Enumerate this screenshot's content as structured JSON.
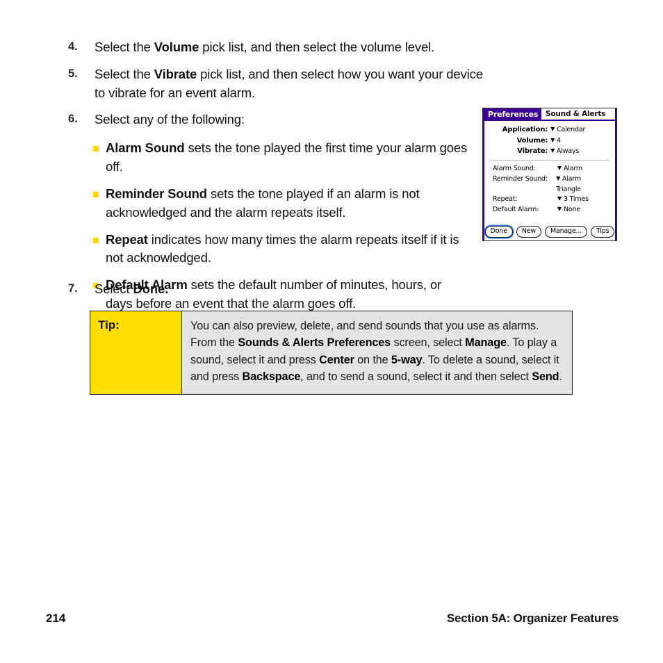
{
  "steps": [
    {
      "number": "4.",
      "parts": [
        {
          "t": "Select the ",
          "b": false
        },
        {
          "t": "Volume",
          "b": true
        },
        {
          "t": " pick list, and then select the volume level.",
          "b": false
        }
      ]
    },
    {
      "number": "5.",
      "parts": [
        {
          "t": "Select the ",
          "b": false
        },
        {
          "t": "Vibrate",
          "b": true
        },
        {
          "t": " pick list, and then select how you want your device to vibrate for an event alarm.",
          "b": false
        }
      ]
    },
    {
      "number": "6.",
      "parts": [
        {
          "t": "Select any of the following:",
          "b": false
        }
      ]
    }
  ],
  "bullets": [
    {
      "parts": [
        {
          "t": "Alarm Sound",
          "b": true
        },
        {
          "t": " sets the tone played the first time your alarm goes off.",
          "b": false
        }
      ]
    },
    {
      "parts": [
        {
          "t": "Reminder Sound",
          "b": true
        },
        {
          "t": " sets the tone played if an alarm  is not acknowledged and the alarm repeats itself.",
          "b": false
        }
      ]
    },
    {
      "parts": [
        {
          "t": "Repeat",
          "b": true
        },
        {
          "t": " indicates how many times the alarm repeats itself if it is not acknowledged.",
          "b": false
        }
      ]
    },
    {
      "parts": [
        {
          "t": "Default Alarm",
          "b": true
        },
        {
          "t": " sets the default number of minutes, hours, or days before an event that the alarm goes off.",
          "b": false
        }
      ]
    }
  ],
  "step7": {
    "number": "7.",
    "parts": [
      {
        "t": "Select ",
        "b": false
      },
      {
        "t": "Done.",
        "b": true
      }
    ]
  },
  "device": {
    "tab_label": "Preferences",
    "screen_title": "Sound & Alerts",
    "top_fields": [
      {
        "label": "Application:",
        "value": "Calendar"
      },
      {
        "label": "Volume:",
        "value": "4"
      },
      {
        "label": "Vibrate:",
        "value": "Always"
      }
    ],
    "lower_fields": [
      {
        "label": "Alarm Sound:",
        "value": "Alarm"
      },
      {
        "label": "Reminder Sound:",
        "value": "Alarm Triangle"
      },
      {
        "label": "Repeat:",
        "value": "3 Times"
      },
      {
        "label": "Default Alarm:",
        "value": "None"
      }
    ],
    "buttons": [
      {
        "label": "Done",
        "focused": true
      },
      {
        "label": "New",
        "focused": false
      },
      {
        "label": "Manage...",
        "focused": false
      },
      {
        "label": "Tips",
        "focused": false
      }
    ],
    "arrow_glyph": "▼",
    "colors": {
      "title_bg": "#3A0095",
      "title_fg": "#FFFFFF",
      "focus_ring": "#2D7DFC"
    }
  },
  "tip": {
    "label": "Tip:",
    "parts": [
      {
        "t": "You can also preview, delete, and send sounds that you use as alarms. From the  ",
        "b": false
      },
      {
        "t": "Sounds & Alerts Preferences",
        "b": true
      },
      {
        "t": " screen, select ",
        "b": false
      },
      {
        "t": "Manage",
        "b": true
      },
      {
        "t": ". To play a sound,  select it and press ",
        "b": false
      },
      {
        "t": "Center",
        "b": true
      },
      {
        "t": " on the ",
        "b": false
      },
      {
        "t": "5-way",
        "b": true
      },
      {
        "t": ". To delete a sound, select it and press ",
        "b": false
      },
      {
        "t": "Backspace",
        "b": true
      },
      {
        "t": ", and to send a sound, select it and then select ",
        "b": false
      },
      {
        "t": "Send",
        "b": true
      },
      {
        "t": ".",
        "b": false
      }
    ],
    "colors": {
      "label_bg": "#FFDF00",
      "body_bg": "#E4E4E4",
      "border": "#1A1A1A"
    }
  },
  "footer": {
    "page_number": "214",
    "section": "Section 5A: Organizer Features"
  },
  "bullet_color": "#FFD900"
}
